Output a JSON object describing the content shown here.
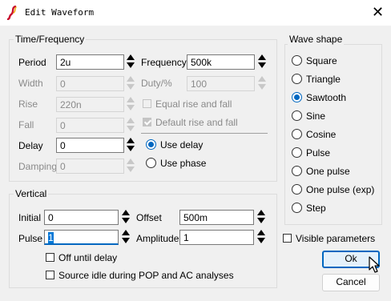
{
  "window": {
    "title": "Edit Waveform",
    "close_glyph": "✕"
  },
  "time_group": {
    "legend": "Time/Frequency",
    "period": {
      "label": "Period",
      "value": "2u"
    },
    "width": {
      "label": "Width",
      "value": "0"
    },
    "rise": {
      "label": "Rise",
      "value": "220n"
    },
    "fall": {
      "label": "Fall",
      "value": "0"
    },
    "delay": {
      "label": "Delay",
      "value": "0"
    },
    "damping": {
      "label": "Damping",
      "value": "0"
    },
    "frequency": {
      "label": "Frequency",
      "value": "500k"
    },
    "duty": {
      "label": "Duty/%",
      "value": "100"
    },
    "equal_rise_fall": {
      "label": "Equal rise and fall",
      "checked": false
    },
    "default_rise_fall": {
      "label": "Default rise and fall",
      "checked": true
    },
    "use_delay": {
      "label": "Use delay",
      "selected": true
    },
    "use_phase": {
      "label": "Use phase",
      "selected": false
    }
  },
  "vertical_group": {
    "legend": "Vertical",
    "initial": {
      "label": "Initial",
      "value": "0"
    },
    "pulse": {
      "label": "Pulse",
      "value": "1"
    },
    "offset": {
      "label": "Offset",
      "value": "500m"
    },
    "amplitude": {
      "label": "Amplitude",
      "value": "1"
    },
    "off_until_delay": {
      "label": "Off until delay",
      "checked": false
    },
    "source_idle": {
      "label": "Source idle during POP and AC analyses",
      "checked": false
    }
  },
  "wave_shape": {
    "legend": "Wave shape",
    "options": [
      {
        "label": "Square",
        "selected": false
      },
      {
        "label": "Triangle",
        "selected": false
      },
      {
        "label": "Sawtooth",
        "selected": true
      },
      {
        "label": "Sine",
        "selected": false
      },
      {
        "label": "Cosine",
        "selected": false
      },
      {
        "label": "Pulse",
        "selected": false
      },
      {
        "label": "One pulse",
        "selected": false
      },
      {
        "label": "One pulse (exp)",
        "selected": false
      },
      {
        "label": "Step",
        "selected": false
      }
    ]
  },
  "visible_parameters": {
    "label": "Visible parameters",
    "checked": false
  },
  "buttons": {
    "ok": "Ok",
    "cancel": "Cancel"
  },
  "colors": {
    "accent": "#0067c0",
    "disabled_text": "#8a8a8a",
    "background": "#f0f0f0"
  }
}
